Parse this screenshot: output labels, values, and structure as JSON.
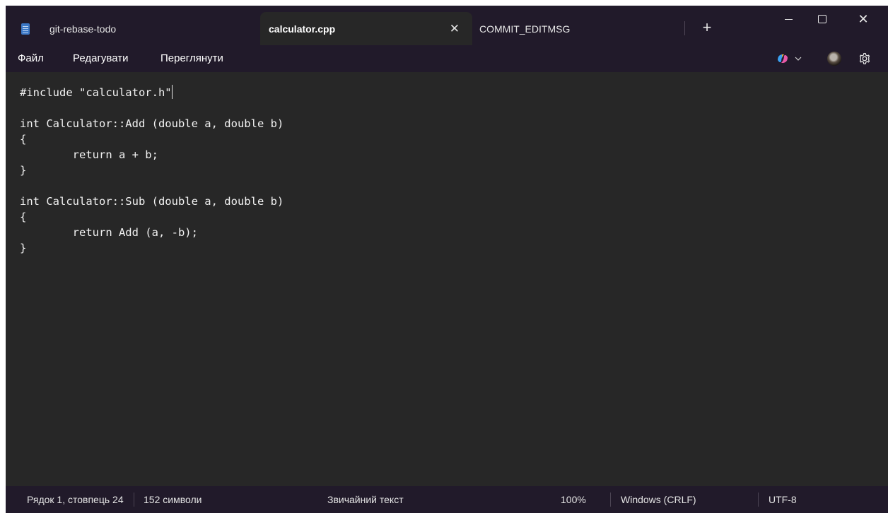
{
  "tabs": [
    {
      "label": "git-rebase-todo",
      "active": false
    },
    {
      "label": "calculator.cpp",
      "active": true
    },
    {
      "label": "COMMIT_EDITMSG",
      "active": false
    }
  ],
  "titlebar": {
    "app_icon": "notepad-icon",
    "new_tab_icon": "plus-icon",
    "close_tab_icon": "close-icon",
    "window_controls": [
      "minimize-icon",
      "maximize-icon",
      "close-icon"
    ]
  },
  "menu": {
    "items": [
      "Файл",
      "Редагувати",
      "Переглянути"
    ],
    "right_icons": [
      "copilot-icon",
      "chevron-down-icon",
      "avatar",
      "gear-icon"
    ]
  },
  "editor": {
    "lines": [
      "#include \"calculator.h\"",
      "",
      "int Calculator::Add (double a, double b)",
      "{",
      "\treturn a + b;",
      "}",
      "",
      "int Calculator::Sub (double a, double b)",
      "{",
      "\treturn Add (a, -b);",
      "}"
    ],
    "caret_line": 1,
    "caret_column": 24
  },
  "status": {
    "position": "Рядок 1, стовпець 24",
    "chars": "152 символи",
    "format": "Звичайний текст",
    "zoom": "100%",
    "line_endings": "Windows (CRLF)",
    "encoding": "UTF-8"
  },
  "colors": {
    "chrome": "#211a2a",
    "editor_bg": "#272727",
    "text": "#f2f2f2"
  }
}
